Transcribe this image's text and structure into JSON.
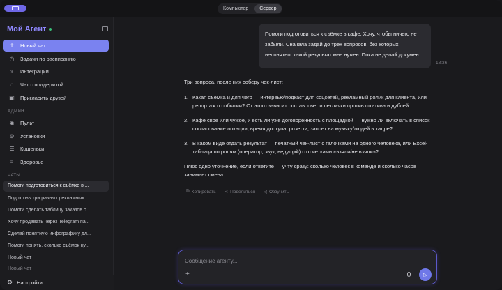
{
  "topbar": {
    "tabs": [
      {
        "label": "Компьютер",
        "active": false
      },
      {
        "label": "Сервер",
        "active": true
      }
    ]
  },
  "sidebar": {
    "brand": "Мой Агент",
    "items": [
      {
        "label": "Новый чат",
        "icon": "plus-icon"
      },
      {
        "label": "Задачи по расписанию",
        "icon": "clock-icon"
      },
      {
        "label": "Интеграции",
        "icon": "plug-icon"
      },
      {
        "label": "Чат с поддержкой",
        "icon": "support-icon"
      },
      {
        "label": "Пригласить друзей",
        "icon": "gift-icon"
      }
    ],
    "admin_label": "АДМИН",
    "admin_items": [
      {
        "label": "Пульт",
        "icon": "eye-icon"
      },
      {
        "label": "Установки",
        "icon": "gear-icon"
      },
      {
        "label": "Кошельки",
        "icon": "list-icon"
      },
      {
        "label": "Здоровье",
        "icon": "lines-icon"
      }
    ],
    "chats_label": "ЧАТЫ",
    "chats": [
      "Помоги подготовиться к съёмке в ...",
      "Подготовь три разных рекламных ...",
      "Помоги сделать таблицу заказов с...",
      "Хочу продавать через Telegram па...",
      "Сделай понятную инфографику дл...",
      "Помоги понять, сколько съёмок ну...",
      "Новый чат",
      "Новый чат"
    ],
    "settings_label": "Настройки"
  },
  "conversation": {
    "user_message": "Помоги подготовиться к съёмке в кафе. Хочу, чтобы ничего не забыли. Сначала задай до трёх вопросов, без которых непонятно, какой результат мне нужен. Пока не делай документ.",
    "time": "18:36",
    "intro": "Три вопроса, после них соберу чек-лист:",
    "questions": [
      {
        "num": "1.",
        "text": "Какая съёмка и для чего — интервью/подкаст для соцсетей, рекламный ролик для клиента, или репортаж о событии? От этого зависит состав: свет и петлички против штатива и дублей."
      },
      {
        "num": "2.",
        "text": "Кафе своё или чужое, и есть ли уже договорённость с площадкой — нужно ли включать в список согласование локации, время доступа, розетки, запрет на музыку/людей в кадре?"
      },
      {
        "num": "3.",
        "text": "В каком виде отдать результат — печатный чек-лист с галочками на одного человека, или Excel-таблица по ролям (оператор, звук, ведущий) с отметками «взяли/не взяли»?"
      }
    ],
    "outro": "Плюс одно уточнение, если ответите — учту сразу: сколько человек в команде и сколько часов занимает смена.",
    "actions": [
      {
        "label": "Копировать",
        "icon": "copy-icon"
      },
      {
        "label": "Поделиться",
        "icon": "share-icon"
      },
      {
        "label": "Озвучить",
        "icon": "speaker-icon"
      }
    ]
  },
  "composer": {
    "placeholder": "Сообщение агенту...",
    "value": ""
  },
  "colors": {
    "accent": "#7a82f0",
    "brand": "#8f88ff",
    "status_online": "#39c27a"
  }
}
